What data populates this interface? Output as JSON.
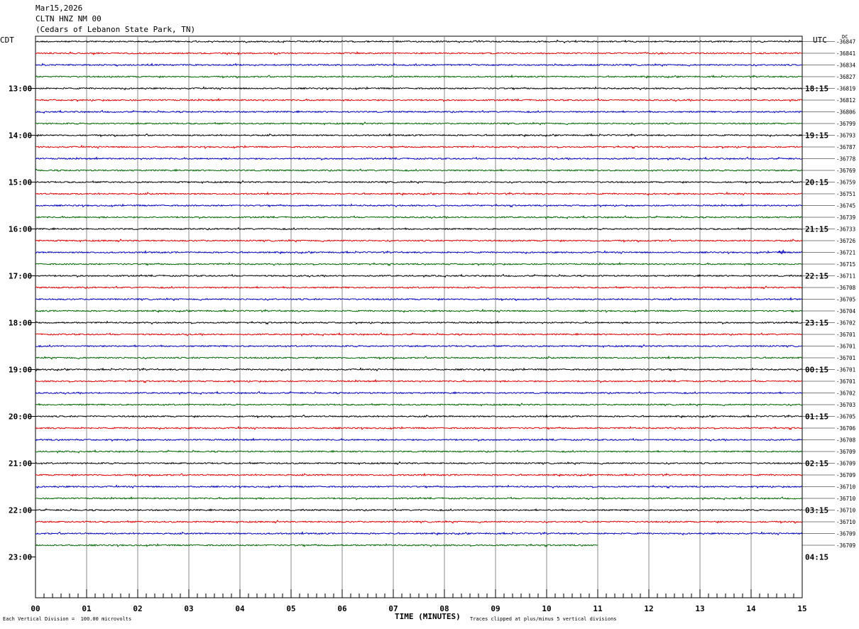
{
  "header": {
    "date": "Mar15,2026",
    "station": "CLTN HNZ NM 00",
    "location": "(Cedars of Lebanon State Park, TN)"
  },
  "labels": {
    "left_timezone": "CDT",
    "right_timezone": "UTC",
    "dc": "DC"
  },
  "footer": {
    "scale_note": "Each Vertical Division =  100.00 microvolts",
    "clip_note": "Traces clipped at plus/minus 5 vertical divisions"
  },
  "chart_data": {
    "type": "line",
    "title": "",
    "xlabel": "TIME (MINUTES)",
    "ylabel": "",
    "xlim": [
      0,
      15
    ],
    "x_ticks": [
      "00",
      "01",
      "02",
      "03",
      "04",
      "05",
      "06",
      "07",
      "08",
      "09",
      "10",
      "11",
      "12",
      "13",
      "14",
      "15"
    ],
    "trace_colors": [
      "#000000",
      "#dd0000",
      "#0000bb",
      "#006600"
    ],
    "left_hour_labels": [
      "13:00",
      "14:00",
      "15:00",
      "16:00",
      "17:00",
      "18:00",
      "19:00",
      "20:00",
      "21:00",
      "22:00",
      "23:00"
    ],
    "right_hour_labels": [
      "18:15",
      "19:15",
      "20:15",
      "21:15",
      "22:15",
      "23:15",
      "00:15",
      "01:15",
      "02:15",
      "03:15",
      "04:15"
    ],
    "dc_offsets": [
      "-36847",
      "-36841",
      "-36834",
      "-36827",
      "-36819",
      "-36812",
      "-36806",
      "-36799",
      "-36793",
      "-36787",
      "-36778",
      "-36769",
      "-36759",
      "-36751",
      "-36745",
      "-36739",
      "-36733",
      "-36726",
      "-36721",
      "-36715",
      "-36711",
      "-36708",
      "-36705",
      "-36704",
      "-36702",
      "-36701",
      "-36701",
      "-36701",
      "-36701",
      "-36701",
      "-36702",
      "-36703",
      "-36705",
      "-36706",
      "-36708",
      "-36709",
      "-36709",
      "-36709",
      "-36710",
      "-36710",
      "-36710",
      "-36710",
      "-36709",
      "-36709"
    ],
    "trace_start_minutes": [
      0,
      0,
      0,
      0,
      0,
      0,
      0,
      0,
      0,
      0,
      0,
      0,
      0,
      0,
      0,
      0,
      0,
      0,
      0,
      0,
      0,
      0,
      0,
      0,
      0,
      0,
      0,
      0,
      0,
      0,
      0,
      0,
      0,
      0,
      0,
      0,
      0,
      0,
      0,
      0,
      0,
      0,
      0,
      0
    ],
    "trace_end_minutes": [
      15,
      15,
      15,
      15,
      15,
      15,
      15,
      15,
      15,
      15,
      15,
      15,
      15,
      15,
      15,
      15,
      15,
      15,
      15,
      15,
      15,
      15,
      15,
      15,
      15,
      15,
      15,
      15,
      15,
      15,
      15,
      15,
      15,
      15,
      15,
      15,
      15,
      15,
      15,
      15,
      15,
      15,
      15,
      11
    ],
    "event": {
      "trace_index": 18,
      "minute": 14.6
    }
  }
}
